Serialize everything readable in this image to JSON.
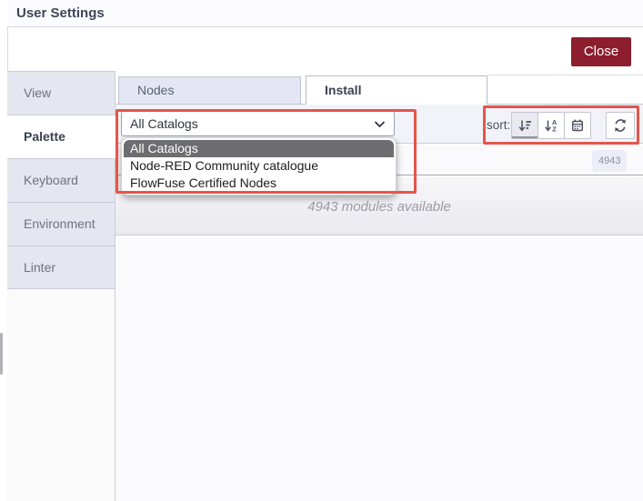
{
  "window": {
    "title": "User Settings"
  },
  "header": {
    "close_label": "Close"
  },
  "sidebar": {
    "selected": "Palette",
    "items": [
      {
        "label": "View"
      },
      {
        "label": "Palette"
      },
      {
        "label": "Keyboard"
      },
      {
        "label": "Environment"
      },
      {
        "label": "Linter"
      }
    ]
  },
  "main_tabs": {
    "selected": "Install",
    "items": [
      {
        "label": "Nodes"
      },
      {
        "label": "Install"
      }
    ]
  },
  "toolbar": {
    "catalog_select": {
      "value": "All Catalogs",
      "chevron_icon": "chevron-down-icon"
    },
    "catalog_dropdown": {
      "highlighted": "All Catalogs",
      "options": [
        "All Catalogs",
        "Node-RED Community catalogue",
        "FlowFuse Certified Nodes"
      ]
    },
    "sort_label": "sort:",
    "sort_buttons": [
      {
        "icon": "sort-amount-desc-icon",
        "active": true
      },
      {
        "icon": "sort-alpha-asc-icon",
        "active": false
      },
      {
        "icon": "calendar-icon",
        "active": false
      }
    ],
    "refresh_icon": "refresh-icon"
  },
  "search": {
    "count_badge": "4943"
  },
  "status_text": "4943 modules available",
  "colors": {
    "close_button": "#8c1e2e",
    "annotation_red": "#e4554a",
    "tab_background": "#e4e6f0",
    "highlighted_option_background": "#6d6d71",
    "icon_stroke": "#4b5160"
  }
}
